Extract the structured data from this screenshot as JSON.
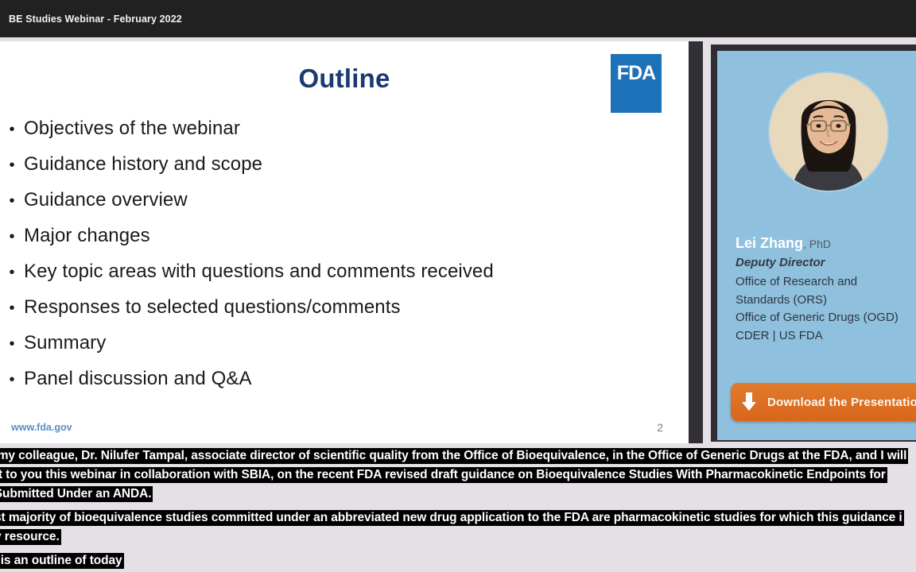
{
  "window": {
    "title": "BE Studies Webinar - February 2022"
  },
  "slide": {
    "title": "Outline",
    "logo_text": "FDA",
    "logo_color": "#1d71b8",
    "title_color": "#1b3a72",
    "bullet_glyph": "•",
    "bullets": [
      "Objectives of the webinar",
      "Guidance history and scope",
      "Guidance overview",
      "Major changes",
      "Key topic areas with questions and comments received",
      "Responses to selected questions/comments",
      "Summary",
      "Panel discussion and Q&A"
    ],
    "footer_url": "www.fda.gov",
    "page_number": "2"
  },
  "speaker_panel": {
    "background_color": "#8fc0dd",
    "name": "Lei Zhang",
    "degree": ", PhD",
    "title": "Deputy Director",
    "affiliation_lines": [
      "Office of Research and",
      "Standards (ORS)",
      "Office of Generic Drugs (OGD)",
      "CDER | US FDA"
    ],
    "download_button": {
      "label": "Download the Presentation",
      "color": "#d9661d",
      "icon": "download-arrow-icon"
    }
  },
  "captions": {
    "lines": [
      "y my colleague, Dr. Nilufer Tampal, associate director of scientific quality from the Office of Bioequivalence, in the Office of Generic Drugs at the FDA, and I will",
      "ent to you this webinar in collaboration with SBIA, on the recent FDA revised draft guidance on Bioequivalence Studies With Pharmacokinetic Endpoints for",
      "s Submitted Under an ANDA.",
      "vast majority of bioequivalence studies committed under an abbreviated new drug application to the FDA are pharmacokinetic studies for which this guidance i",
      "key resource.",
      "e is an outline of today"
    ]
  }
}
